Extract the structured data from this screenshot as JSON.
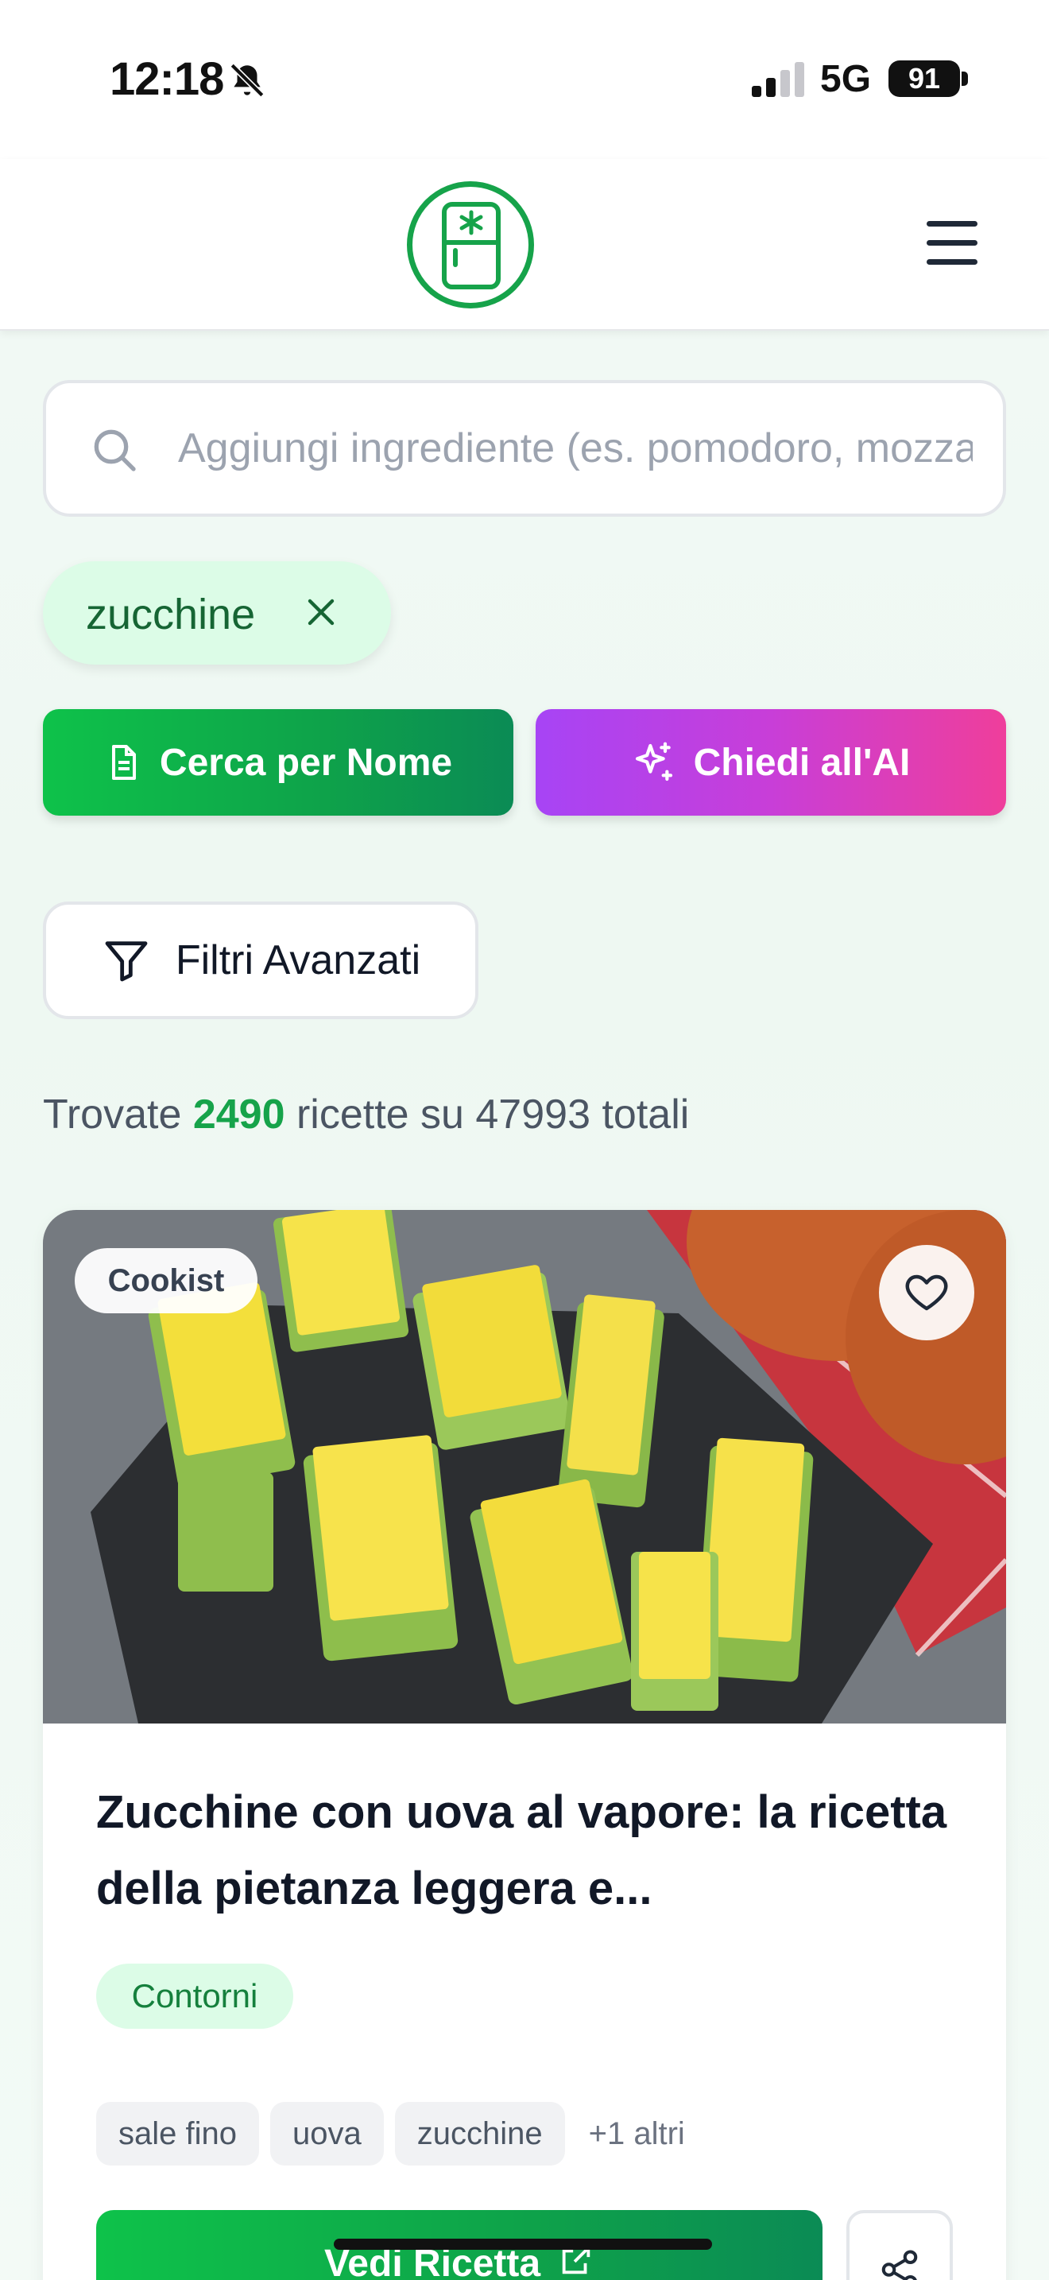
{
  "status_bar": {
    "time": "12:18",
    "network": "5G",
    "battery": "91"
  },
  "search": {
    "placeholder": "Aggiungi ingrediente (es. pomodoro, mozzarella)"
  },
  "selected_ingredients": [
    {
      "label": "zucchine"
    }
  ],
  "actions": {
    "search_by_name": "Cerca per Nome",
    "ask_ai": "Chiedi all'AI",
    "advanced_filters": "Filtri Avanzati"
  },
  "results": {
    "prefix": "Trovate",
    "found": "2490",
    "middle": "ricette su",
    "total": "47993",
    "suffix": "totali"
  },
  "recipe_card": {
    "source": "Cookist",
    "title": "Zucchine con uova al vapore: la ricetta della pietanza leggera e...",
    "category": "Contorni",
    "ingredients": [
      "sale fino",
      "uova",
      "zucchine"
    ],
    "more_ingredients": "+1 altri",
    "view_button": "Vedi Ricetta"
  },
  "colors": {
    "brand_green": "#16a34a",
    "ai_gradient_start": "#a744f5",
    "ai_gradient_end": "#ef3e9b",
    "chip_bg": "#dcfce7"
  },
  "icons": {
    "logo": "fridge-icon",
    "menu": "hamburger-menu-icon",
    "search": "search-icon",
    "remove_chip": "close-icon",
    "search_by_name": "document-icon",
    "ask_ai": "sparkles-icon",
    "filters": "funnel-icon",
    "favorite": "heart-icon",
    "share": "share-icon",
    "external": "external-link-icon"
  }
}
